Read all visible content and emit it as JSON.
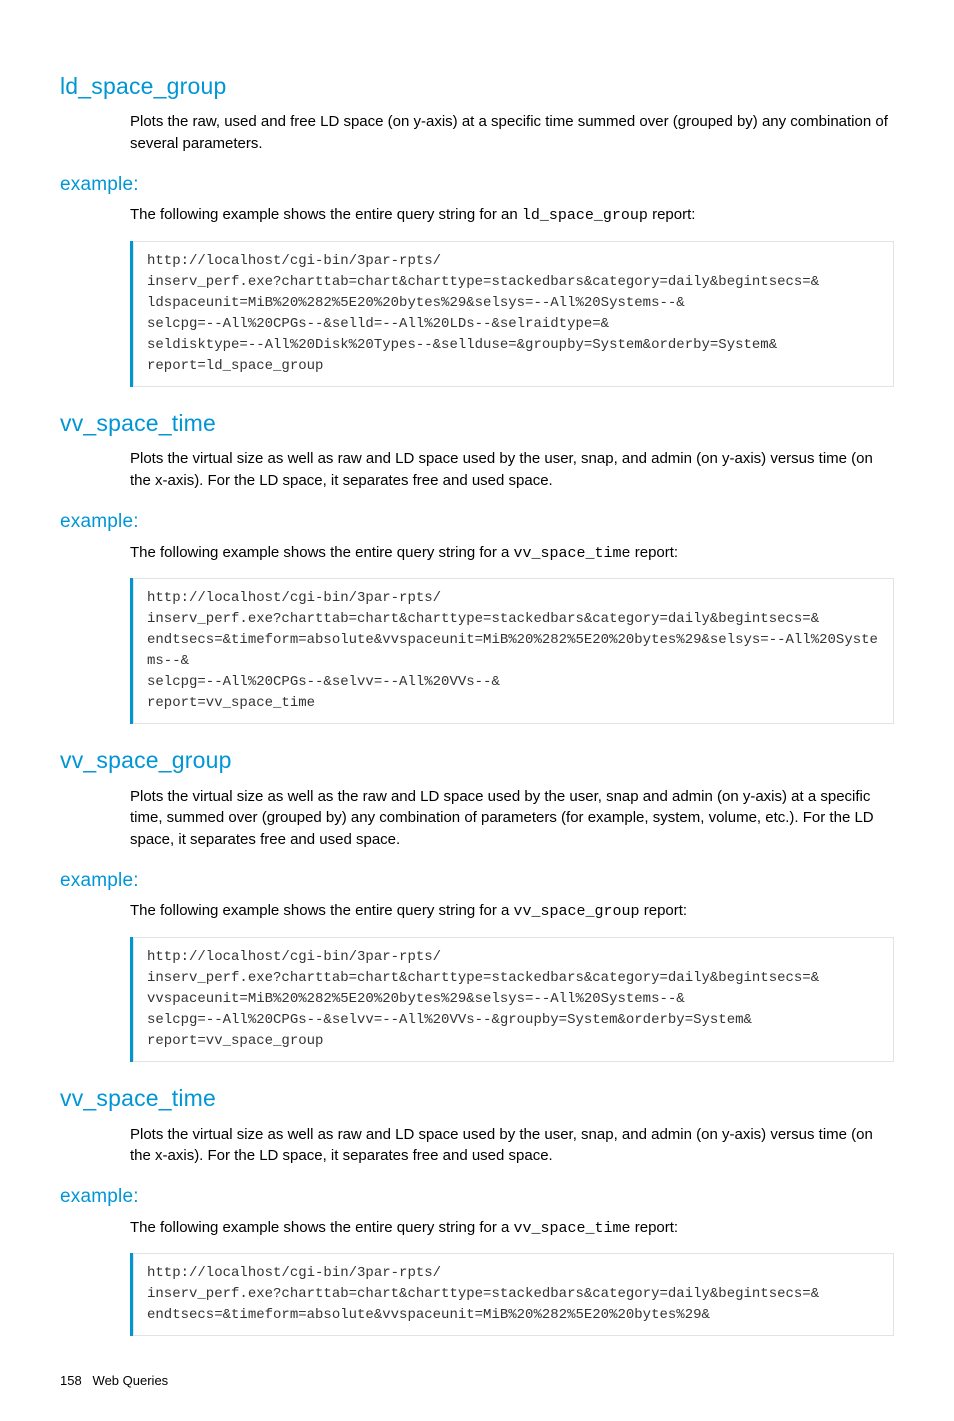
{
  "sections": [
    {
      "heading": "ld_space_group",
      "description": "Plots the raw, used and free LD space (on y-axis) at a specific time summed over (grouped by) any combination of several parameters.",
      "example_intro_pre": "The following example shows the entire query string for an ",
      "example_code_name": "ld_space_group",
      "example_intro_post": " report:",
      "code": "http://localhost/cgi-bin/3par-rpts/\ninserv_perf.exe?charttab=chart&charttype=stackedbars&category=daily&begintsecs=&\nldspaceunit=MiB%20%282%5E20%20bytes%29&selsys=--All%20Systems--&\nselcpg=--All%20CPGs--&selld=--All%20LDs--&selraidtype=&\nseldisktype=--All%20Disk%20Types--&sellduse=&groupby=System&orderby=System&\nreport=ld_space_group"
    },
    {
      "heading": "vv_space_time",
      "description": "Plots the virtual size as well as raw and LD space used by the user, snap, and admin (on y-axis) versus time (on the x-axis). For the LD space, it separates free and used space.",
      "example_intro_pre": "The following example shows the entire query string for a ",
      "example_code_name": "vv_space_time",
      "example_intro_post": " report:",
      "code": "http://localhost/cgi-bin/3par-rpts/\ninserv_perf.exe?charttab=chart&charttype=stackedbars&category=daily&begintsecs=&\nendtsecs=&timeform=absolute&vvspaceunit=MiB%20%282%5E20%20bytes%29&selsys=--All%20Systems--&\nselcpg=--All%20CPGs--&selvv=--All%20VVs--&\nreport=vv_space_time"
    },
    {
      "heading": "vv_space_group",
      "description": "Plots the virtual size as well as the raw and LD space used by the user, snap and admin (on y-axis) at a specific time, summed over (grouped by) any combination of parameters (for example, system, volume, etc.). For the LD space, it separates free and used space.",
      "example_intro_pre": "The following example shows the entire query string for a ",
      "example_code_name": "vv_space_group",
      "example_intro_post": " report:",
      "code": "http://localhost/cgi-bin/3par-rpts/\ninserv_perf.exe?charttab=chart&charttype=stackedbars&category=daily&begintsecs=&\nvvspaceunit=MiB%20%282%5E20%20bytes%29&selsys=--All%20Systems--&\nselcpg=--All%20CPGs--&selvv=--All%20VVs--&groupby=System&orderby=System&\nreport=vv_space_group"
    },
    {
      "heading": "vv_space_time",
      "description": "Plots the virtual size as well as raw and LD space used by the user, snap, and admin (on y-axis) versus time (on the x-axis). For the LD space, it separates free and used space.",
      "example_intro_pre": "The following example shows the entire query string for a ",
      "example_code_name": "vv_space_time",
      "example_intro_post": " report:",
      "code": "http://localhost/cgi-bin/3par-rpts/\ninserv_perf.exe?charttab=chart&charttype=stackedbars&category=daily&begintsecs=&\nendtsecs=&timeform=absolute&vvspaceunit=MiB%20%282%5E20%20bytes%29&"
    }
  ],
  "example_label": "example:",
  "footer": {
    "page_number": "158",
    "title": "Web Queries"
  }
}
